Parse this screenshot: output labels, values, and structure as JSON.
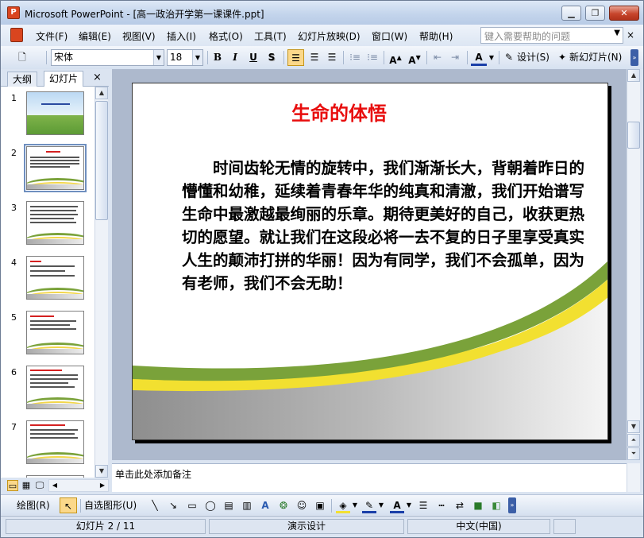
{
  "window": {
    "title": "Microsoft PowerPoint - [高一政治开学第一课课件.ppt]",
    "app_icon": "P",
    "minimize_label": "▁",
    "restore_label": "❐",
    "close_label": "✕"
  },
  "menu": {
    "items": [
      "文件(F)",
      "编辑(E)",
      "视图(V)",
      "插入(I)",
      "格式(O)",
      "工具(T)",
      "幻灯片放映(D)",
      "窗口(W)",
      "帮助(H)"
    ],
    "help_placeholder": "键入需要帮助的问题",
    "close_doc": "×"
  },
  "toolbar": {
    "font_name": "宋体",
    "font_size": "18",
    "bold": "B",
    "italic": "I",
    "underline": "U",
    "shadow": "S",
    "design_label": "设计(S)",
    "new_slide_label": "新幻灯片(N)",
    "active_alignment": "left"
  },
  "panel": {
    "tab_outline": "大纲",
    "tab_slides": "幻灯片",
    "close": "×",
    "slide_numbers": [
      "1",
      "2",
      "3",
      "4",
      "5",
      "6",
      "7"
    ],
    "selected_slide": 2
  },
  "slide": {
    "title": "生命的体悟",
    "body": "时间齿轮无情的旋转中，我们渐渐长大，背朝着昨日的懵懂和幼稚，延续着青春年华的纯真和清澈，我们开始谱写生命中最激越最绚丽的乐章。期待更美好的自己，收获更热切的愿望。就让我们在这段必将一去不复的日子里享受真实人生的颠沛打拼的华丽！因为有同学，我们不会孤单，因为有老师，我们不会无助！",
    "colors": {
      "title": "#e80e0e",
      "swoosh_green": "#7aa23a",
      "swoosh_yellow": "#f2e030",
      "base_gray": "#9a9a9a"
    }
  },
  "notes": {
    "placeholder": "单击此处添加备注"
  },
  "drawing": {
    "draw_label": "绘图(R)",
    "autoshapes_label": "自选图形(U)"
  },
  "status": {
    "slide_position": "幻灯片 2 / 11",
    "design": "演示设计",
    "language": "中文(中国)"
  }
}
